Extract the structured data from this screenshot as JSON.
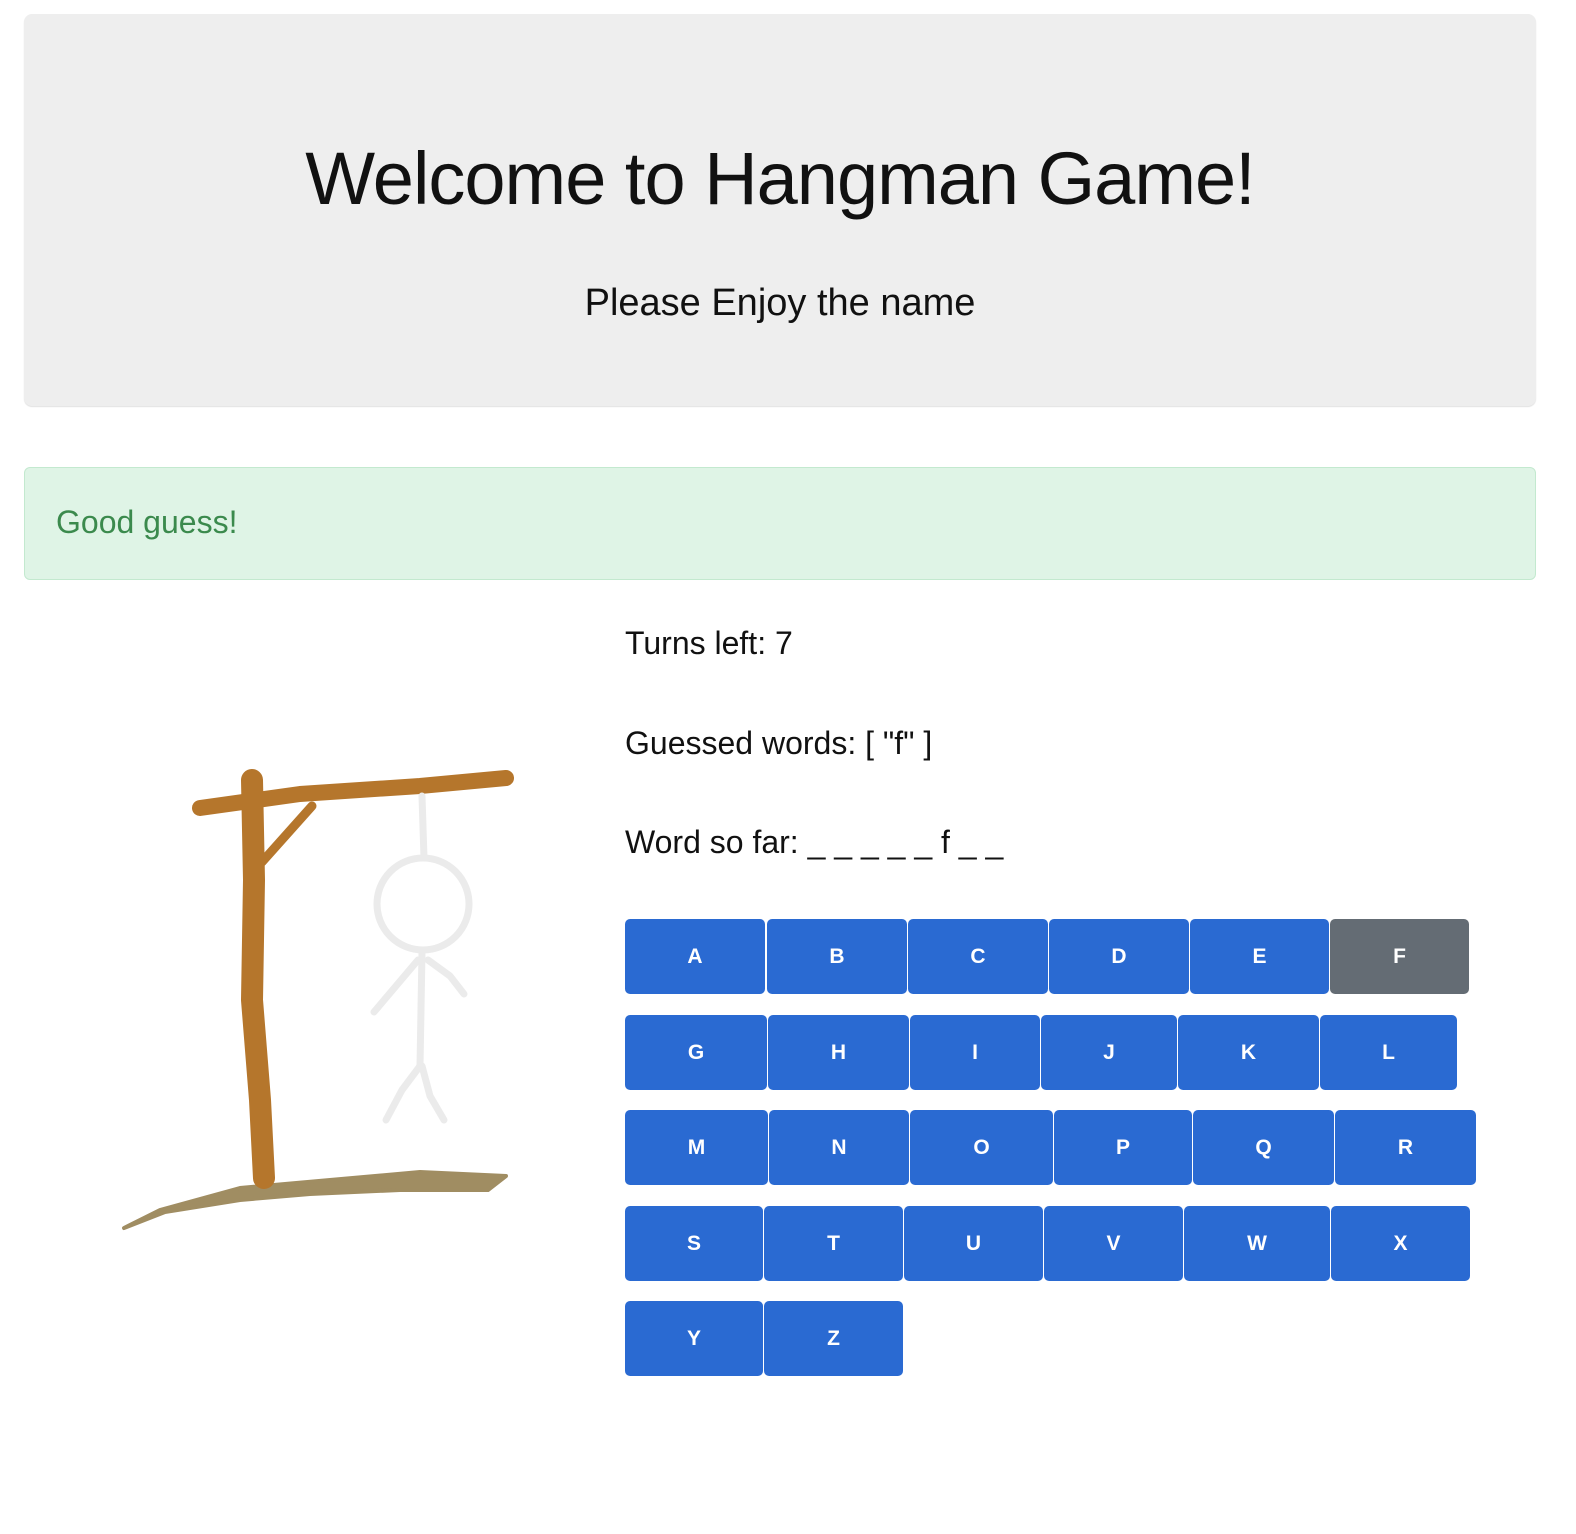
{
  "header": {
    "title": "Welcome to Hangman Game!",
    "subtitle": "Please Enjoy the name"
  },
  "alert": {
    "message": "Good guess!",
    "color": "#3b8a4d"
  },
  "status": {
    "turns_left_label": "Turns left:",
    "turns_left": "7",
    "guessed_label": "Guessed words:",
    "guessed_value": "[ \"f\" ]",
    "word_label": "Word so far:",
    "word_value": "_ _ _ _ _ f _ _"
  },
  "keyboard": {
    "rows": [
      [
        "A",
        "B",
        "C",
        "D",
        "E",
        "F"
      ],
      [
        "G",
        "H",
        "I",
        "J",
        "K",
        "L"
      ],
      [
        "M",
        "N",
        "O",
        "P",
        "Q",
        "R"
      ],
      [
        "S",
        "T",
        "U",
        "V",
        "W",
        "X"
      ],
      [
        "Y",
        "Z"
      ]
    ],
    "used": [
      "F"
    ]
  },
  "colors": {
    "key": "#2a6ad2",
    "key_used": "#646c74",
    "gallows": "#b5762c",
    "ground": "#a08d62",
    "figure": "#ebebeb"
  }
}
